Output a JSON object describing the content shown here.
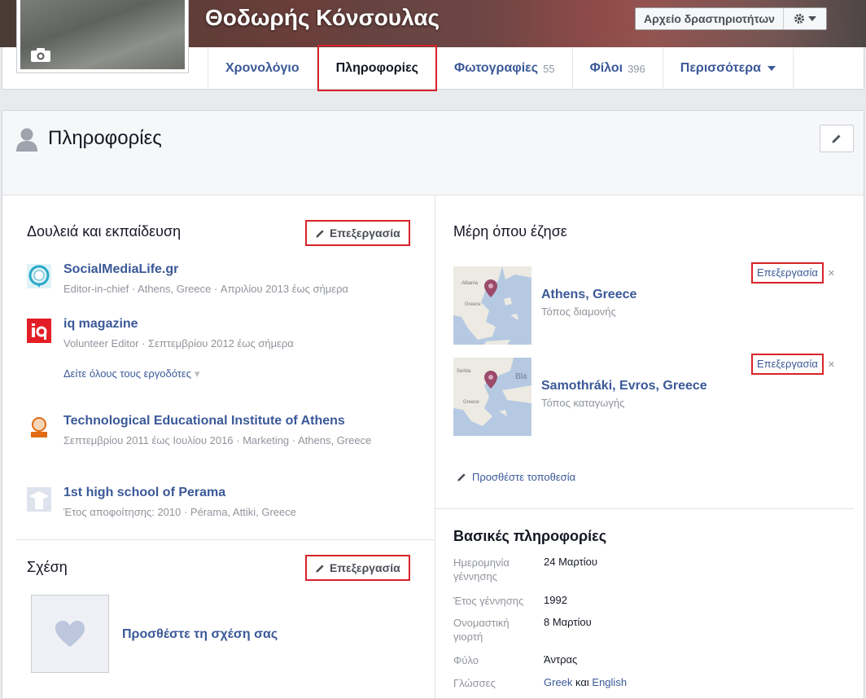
{
  "header": {
    "profile_name": "Θοδωρής Κόνσουλας",
    "activity_log_label": "Αρχείο δραστηριοτήτων"
  },
  "tabs": [
    {
      "label": "Χρονολόγιο",
      "count": ""
    },
    {
      "label": "Πληροφορίες",
      "count": "",
      "active": true
    },
    {
      "label": "Φωτογραφίες",
      "count": "55"
    },
    {
      "label": "Φίλοι",
      "count": "396"
    },
    {
      "label": "Περισσότερα",
      "count": ""
    }
  ],
  "about": {
    "title": "Πληροφορίες"
  },
  "work": {
    "title": "Δουλειά και εκπαίδευση",
    "edit_label": "Επεξεργασία",
    "items": [
      {
        "name": "SocialMediaLife.gr",
        "meta": "Editor-in-chief · Athens, Greece · Απριλίου 2013 έως σήμερα"
      },
      {
        "name": "iq magazine",
        "meta": "Volunteer Editor · Σεπτεμβρίου 2012 έως σήμερα"
      },
      {
        "name": "Technological Educational Institute of Athens",
        "meta": "Σεπτεμβρίου 2011 έως Ιουλίου 2016 · Marketing · Athens, Greece"
      },
      {
        "name": "1st high school of Perama",
        "meta": "Έτος αποφοίτησης: 2010 · Pérama, Attiki, Greece"
      }
    ],
    "see_all": "Δείτε όλους τους εργοδότες"
  },
  "relationship": {
    "title": "Σχέση",
    "edit_label": "Επεξεργασία",
    "add_label": "Προσθέστε τη σχέση σας"
  },
  "places": {
    "title": "Μέρη όπου έζησε",
    "items": [
      {
        "name": "Athens, Greece",
        "type": "Τόπος διαμονής",
        "edit": "Επεξεργασία",
        "close": "×",
        "map_labels": [
          "Albania",
          "Greece"
        ]
      },
      {
        "name": "Samothráki, Evros, Greece",
        "type": "Τόπος καταγωγής",
        "edit": "Επεξεργασία",
        "close": "×",
        "map_labels": [
          "Serbia",
          "Bla",
          "Greece"
        ]
      }
    ],
    "add_label": "Προσθέστε τοποθεσία"
  },
  "basic": {
    "title": "Βασικές πληροφορίες",
    "rows": [
      {
        "key": "Ημερομηνία γέννησης",
        "value": "24 Μαρτίου"
      },
      {
        "key": "Έτος γέννησης",
        "value": "1992"
      },
      {
        "key": "Ονομαστική γιορτή",
        "value": "8 Μαρτίου"
      },
      {
        "key": "Φύλο",
        "value": "Άντρας"
      }
    ],
    "languages_key": "Γλώσσες",
    "languages": [
      "Greek",
      "και",
      "English"
    ]
  },
  "colors": {
    "link": "#3b5998",
    "highlight": "#d8232a",
    "muted": "#90949c"
  }
}
